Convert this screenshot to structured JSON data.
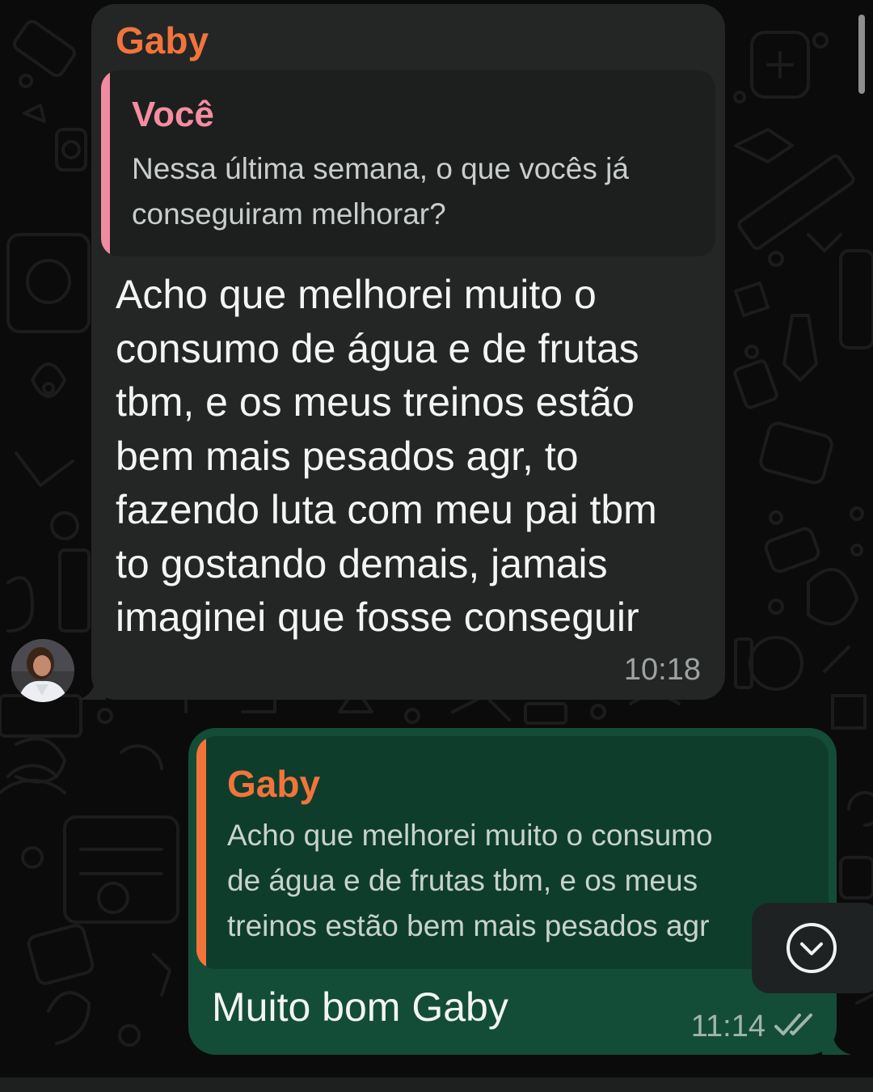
{
  "incoming": {
    "sender": "Gaby",
    "quote": {
      "author": "Você",
      "lines": [
        "Nessa última semana, o que vocês já",
        "conseguiram melhorar?"
      ]
    },
    "lines": [
      "Acho que melhorei muito o",
      "consumo de água e de frutas",
      "tbm, e os meus treinos estão",
      "bem mais pesados agr, to",
      "fazendo luta com meu pai tbm",
      "to gostando demais, jamais",
      "imaginei que fosse conseguir"
    ],
    "time": "10:18",
    "avatar_icon": "contact-photo"
  },
  "outgoing": {
    "quote": {
      "author": "Gaby",
      "lines": [
        "Acho que melhorei muito o consumo",
        "de água e de frutas tbm, e os meus",
        "treinos estão bem mais pesados agr"
      ]
    },
    "text": "Muito bom Gaby",
    "time": "11:14",
    "status_icon": "double-check-icon"
  },
  "scroll_button_icon": "chevron-down-circle-icon",
  "colors": {
    "background": "#0b0b0b",
    "incoming_bubble": "#242626",
    "outgoing_bubble": "#144d37",
    "sender_name": "#f2743b",
    "quote_author_self": "#f48da0"
  }
}
